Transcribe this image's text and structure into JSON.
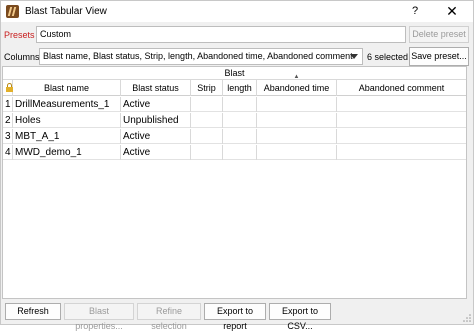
{
  "window": {
    "title": "Blast Tabular View",
    "help_label": "?",
    "close_label": "✕"
  },
  "presets": {
    "label": "Presets",
    "value": "Custom",
    "delete_label": "Delete preset"
  },
  "columns": {
    "label": "Columns",
    "value": "Blast name, Blast status, Strip, length, Abandoned time, Abandoned comment",
    "selected_count": "6 selected",
    "save_label": "Save preset..."
  },
  "grid": {
    "group_header": "Blast",
    "headers": [
      "Blast name",
      "Blast status",
      "Strip",
      "length",
      "Abandoned time",
      "Abandoned comment"
    ],
    "rows": [
      {
        "num": "1",
        "name": "DrillMeasurements_1",
        "status": "Active",
        "strip": "",
        "length": "",
        "abandoned_time": "",
        "abandoned_comment": ""
      },
      {
        "num": "2",
        "name": "Holes",
        "status": "Unpublished",
        "strip": "",
        "length": "",
        "abandoned_time": "",
        "abandoned_comment": ""
      },
      {
        "num": "3",
        "name": "MBT_A_1",
        "status": "Active",
        "strip": "",
        "length": "",
        "abandoned_time": "",
        "abandoned_comment": ""
      },
      {
        "num": "4",
        "name": "MWD_demo_1",
        "status": "Active",
        "strip": "",
        "length": "",
        "abandoned_time": "",
        "abandoned_comment": ""
      }
    ]
  },
  "actions": {
    "refresh": "Refresh",
    "blast_properties": "Blast properties...",
    "refine_selection": "Refine selection",
    "export_report": "Export to report",
    "export_csv": "Export to CSV..."
  },
  "colors": {
    "presets_label": "#c81e1e",
    "app_icon": "#7a4a1e",
    "lock_icon": "#e2b02a"
  },
  "icons": [
    "app-icon",
    "help-icon",
    "close-icon",
    "lock-icon",
    "dropdown-arrow-icon",
    "sort-indicator-icon",
    "resize-grip-icon"
  ]
}
